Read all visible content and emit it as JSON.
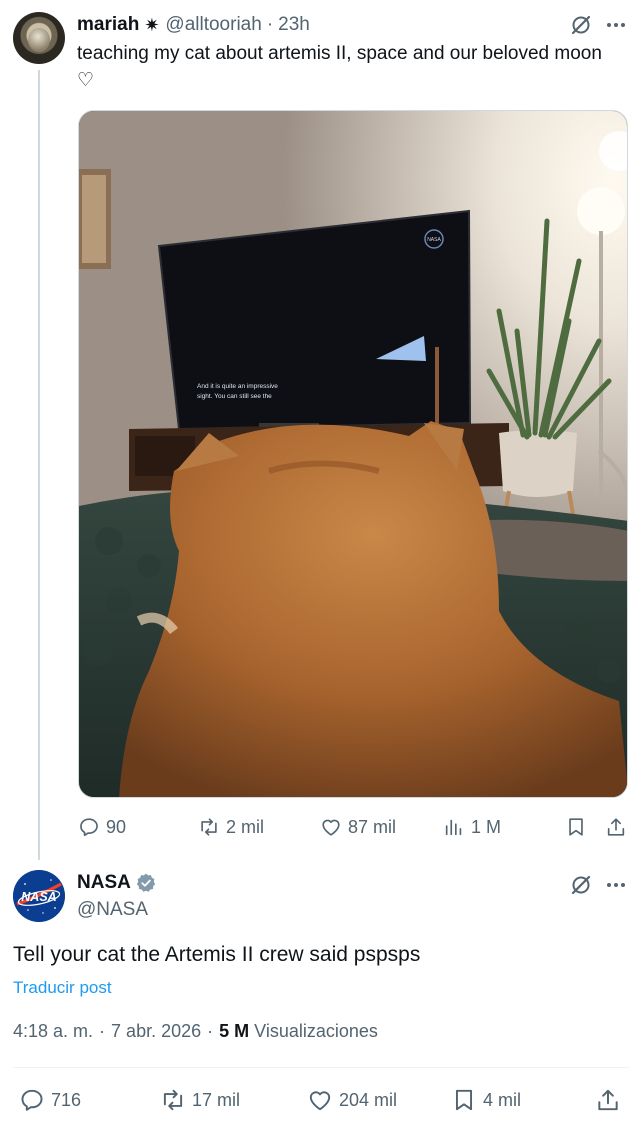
{
  "parent_post": {
    "display_name": "mariah",
    "name_glyph": "✷",
    "handle": "@alltooriah",
    "separator": "·",
    "time": "23h",
    "text": "teaching my cat about artemis II, space and our beloved moon ♡",
    "media": {
      "tv_logo": "NASA",
      "subtitle_line1": "And it is quite an impressive",
      "subtitle_line2": "sight. You can still see the"
    },
    "stats": {
      "replies": "90",
      "reposts": "2 mil",
      "likes": "87 mil",
      "views": "1 M"
    }
  },
  "main_post": {
    "display_name": "NASA",
    "handle": "@NASA",
    "avatar_text": "NASA",
    "text": "Tell your cat the Artemis II crew said pspsps",
    "translate_link": "Traducir post",
    "time": "4:18 a. m.",
    "separator": "·",
    "date": "7 abr. 2026",
    "views_count": "5 M",
    "views_label": "Visualizaciones",
    "stats": {
      "replies": "716",
      "reposts": "17 mil",
      "likes": "204 mil",
      "bookmarks": "4 mil"
    }
  },
  "colors": {
    "text_primary": "#0f1419",
    "text_secondary": "#536471",
    "link": "#1d9bf0",
    "verified": "#829aab",
    "nasa_blue": "#0b3d91",
    "nasa_red": "#fc3d21"
  },
  "icons": [
    "grok-icon",
    "more-icon",
    "reply-icon",
    "repost-icon",
    "like-icon",
    "views-icon",
    "bookmark-icon",
    "share-icon",
    "verified-icon"
  ]
}
